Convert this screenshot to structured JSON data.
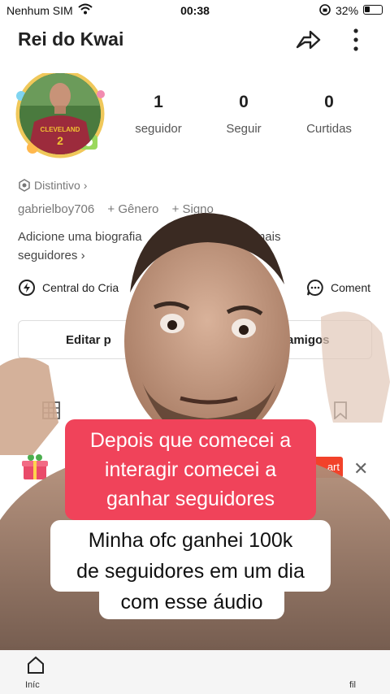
{
  "status_bar": {
    "carrier": "Nenhum SIM",
    "time": "00:38",
    "battery": "32%"
  },
  "profile": {
    "title": "Rei do Kwai",
    "stats": [
      {
        "value": "1",
        "label": "seguidor"
      },
      {
        "value": "0",
        "label": "Seguir"
      },
      {
        "value": "0",
        "label": "Curtidas"
      }
    ],
    "badge_label": "Distintivo",
    "username": "gabrielboy706",
    "gender_link": "+ Gênero",
    "sign_link": "+ Signo",
    "bio_line1": "Adicione uma biografia",
    "bio_line1_end": "ganhar mais",
    "bio_line2": "seguidores",
    "creator_center": "Central do Cria",
    "comments": "Coment",
    "edit_button": "Editar p",
    "add_friends_button": "r amigos",
    "promo_button": "art"
  },
  "bottom_nav": {
    "home_label": "Iníc",
    "profile_label": "fil"
  },
  "captions": {
    "red": [
      "Depois que comecei a",
      "interagir comecei a",
      "ganhar seguidores"
    ],
    "white": [
      "Minha ofc ganhei 100k",
      "de seguidores em um dia"
    ],
    "white_tail": "com esse áudio"
  },
  "colors": {
    "caption_red": "#f0435a",
    "promo_orange": "#f2422a"
  },
  "icons": {
    "share": "share-arrow-icon",
    "more": "more-vertical-icon",
    "badge": "badge-hexagon-icon",
    "creator": "lightning-circle-icon",
    "comments": "chat-bubble-icon",
    "grid": "grid-icon",
    "bookmark": "bookmark-icon",
    "gift": "gift-icon",
    "close": "close-icon",
    "home": "home-icon"
  }
}
